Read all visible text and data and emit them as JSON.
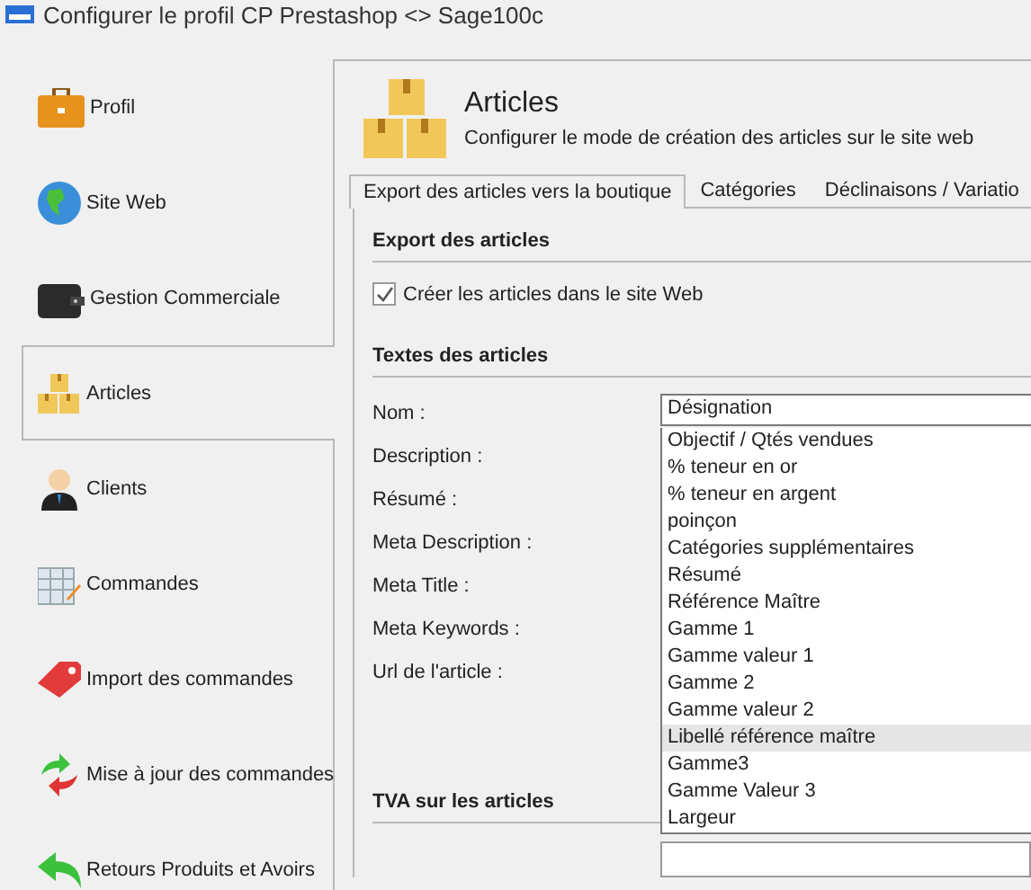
{
  "window": {
    "title": "Configurer le profil CP Prestashop <> Sage100c"
  },
  "sidebar": {
    "items": [
      {
        "label": "Profil",
        "selected": false
      },
      {
        "label": "Site Web",
        "selected": false
      },
      {
        "label": "Gestion Commerciale",
        "selected": false
      },
      {
        "label": "Articles",
        "selected": true
      },
      {
        "label": "Clients",
        "selected": false
      },
      {
        "label": "Commandes",
        "selected": false
      },
      {
        "label": "Import des commandes",
        "selected": false
      },
      {
        "label": "Mise à jour des commandes",
        "selected": false
      },
      {
        "label": "Retours Produits et Avoirs",
        "selected": false
      }
    ]
  },
  "header": {
    "title": "Articles",
    "subtitle": "Configurer le mode de création des articles sur le site web"
  },
  "tabs": [
    {
      "label": "Export des articles vers la boutique",
      "selected": true
    },
    {
      "label": "Catégories",
      "selected": false
    },
    {
      "label": "Déclinaisons / Variatio",
      "selected": false
    }
  ],
  "export_section": {
    "heading": "Export des articles",
    "checkbox": {
      "label": "Créer les articles dans le site Web",
      "checked": true
    }
  },
  "texts_section": {
    "heading": "Textes des articles",
    "fields": [
      {
        "label": "Nom :",
        "value": "Désignation"
      },
      {
        "label": "Description :"
      },
      {
        "label": "Résumé :"
      },
      {
        "label": "Meta Description :"
      },
      {
        "label": "Meta Title :"
      },
      {
        "label": "Meta Keywords :"
      },
      {
        "label": "Url de l'article :"
      }
    ]
  },
  "dropdown": {
    "options": [
      {
        "label": "Objectif / Qtés vendues",
        "selected": false
      },
      {
        "label": "% teneur en or",
        "selected": false
      },
      {
        "label": "% teneur en argent",
        "selected": false
      },
      {
        "label": "poinçon",
        "selected": false
      },
      {
        "label": "Catégories supplémentaires",
        "selected": false
      },
      {
        "label": "Résumé",
        "selected": false
      },
      {
        "label": "Référence Maître",
        "selected": false
      },
      {
        "label": "Gamme 1",
        "selected": false
      },
      {
        "label": "Gamme valeur 1",
        "selected": false
      },
      {
        "label": "Gamme 2",
        "selected": false
      },
      {
        "label": "Gamme valeur 2",
        "selected": false
      },
      {
        "label": "Libellé référence maître",
        "selected": true
      },
      {
        "label": "Gamme3",
        "selected": false
      },
      {
        "label": "Gamme Valeur 3",
        "selected": false
      },
      {
        "label": "Largeur",
        "selected": false
      }
    ]
  },
  "vat_section": {
    "heading": "TVA sur les articles"
  }
}
